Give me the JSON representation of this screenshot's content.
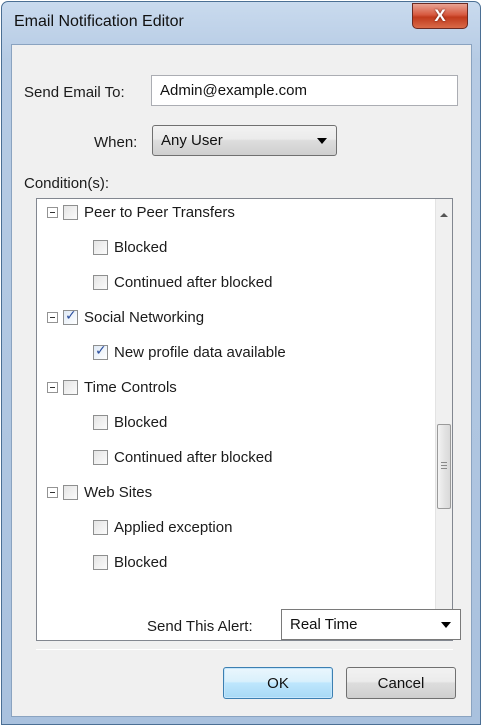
{
  "window": {
    "title": "Email Notification Editor",
    "close_symbol": "X"
  },
  "form": {
    "send_to_label": "Send Email To:",
    "send_to_value": "Admin@example.com",
    "when_label": "When:",
    "when_value": "Any User",
    "conditions_label": "Condition(s):",
    "send_alert_label": "Send This Alert:",
    "send_alert_value": "Real Time"
  },
  "tree": {
    "items": [
      {
        "label": "Peer to Peer Transfers",
        "level": 0,
        "checked": false
      },
      {
        "label": "Blocked",
        "level": 1,
        "checked": false
      },
      {
        "label": "Continued after blocked",
        "level": 1,
        "checked": false
      },
      {
        "label": "Social Networking",
        "level": 0,
        "checked": true
      },
      {
        "label": "New profile data available",
        "level": 1,
        "checked": true
      },
      {
        "label": "Time Controls",
        "level": 0,
        "checked": false
      },
      {
        "label": "Blocked",
        "level": 1,
        "checked": false
      },
      {
        "label": "Continued after blocked",
        "level": 1,
        "checked": false
      },
      {
        "label": "Web Sites",
        "level": 0,
        "checked": false
      },
      {
        "label": "Applied exception",
        "level": 1,
        "checked": false
      },
      {
        "label": "Blocked",
        "level": 1,
        "checked": false
      }
    ]
  },
  "buttons": {
    "ok": "OK",
    "cancel": "Cancel"
  }
}
